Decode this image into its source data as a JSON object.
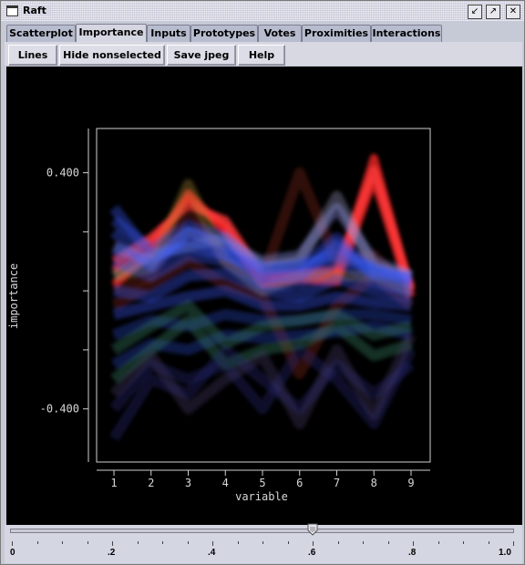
{
  "window": {
    "title": "Raft"
  },
  "tabs": [
    {
      "label": "Scatterplot",
      "active": false
    },
    {
      "label": "Importance",
      "active": true
    },
    {
      "label": "Inputs",
      "active": false
    },
    {
      "label": "Prototypes",
      "active": false
    },
    {
      "label": "Votes",
      "active": false
    },
    {
      "label": "Proximities",
      "active": false
    },
    {
      "label": "Interactions",
      "active": false
    }
  ],
  "toolbar": {
    "lines": "Lines",
    "hide_nonselected": "Hide nonselected",
    "save_jpeg": "Save jpeg",
    "help": "Help"
  },
  "colors": {
    "plot_bg": "#000000",
    "frame": "#d0d0d0",
    "highlight": "#ff2a2a",
    "bulk": "#3a5cff"
  },
  "chart_data": {
    "type": "line",
    "xlabel": "variable",
    "ylabel": "importance",
    "x": [
      1,
      2,
      3,
      4,
      5,
      6,
      7,
      8,
      9
    ],
    "y_ticks": [
      "0.400",
      "-0.400"
    ],
    "ylim": [
      -0.58,
      0.55
    ],
    "series": [
      {
        "color": "#ff2a2a",
        "values": [
          0.07,
          0.16,
          0.31,
          0.22,
          0.03,
          0.05,
          0.05,
          0.45,
          0.0
        ]
      },
      {
        "color": "#ff2a2a",
        "values": [
          0.02,
          0.13,
          0.33,
          0.2,
          0.02,
          0.04,
          0.03,
          0.38,
          -0.02
        ]
      },
      {
        "color": "#ff3a3a",
        "values": [
          0.1,
          0.18,
          0.29,
          0.24,
          0.05,
          0.06,
          0.07,
          0.41,
          0.01
        ]
      },
      {
        "color": "#8a2a1a",
        "values": [
          0.0,
          0.05,
          0.28,
          0.1,
          0.04,
          0.4,
          0.1,
          0.12,
          -0.02
        ]
      },
      {
        "color": "#8a2a1a",
        "values": [
          -0.05,
          0.02,
          0.1,
          0.02,
          -0.02,
          -0.28,
          -0.05,
          0.05,
          -0.05
        ]
      },
      {
        "color": "#a0a0c8",
        "values": [
          0.05,
          0.12,
          0.15,
          0.18,
          0.08,
          0.1,
          0.32,
          0.08,
          0.05
        ]
      },
      {
        "color": "#9aa0ff",
        "values": [
          0.15,
          0.1,
          0.2,
          0.16,
          0.1,
          0.12,
          0.28,
          0.1,
          0.05
        ]
      },
      {
        "color": "#b08a30",
        "values": [
          0.05,
          0.08,
          0.36,
          0.1,
          0.0,
          0.05,
          0.05,
          0.05,
          0.0
        ]
      },
      {
        "color": "#3a5cff",
        "values": [
          0.28,
          0.12,
          0.15,
          0.12,
          0.08,
          0.08,
          0.18,
          0.06,
          0.05
        ]
      },
      {
        "color": "#3a5cff",
        "values": [
          0.2,
          0.08,
          0.2,
          0.15,
          0.05,
          0.06,
          0.14,
          0.08,
          0.03
        ]
      },
      {
        "color": "#3a5cff",
        "values": [
          0.1,
          0.05,
          0.12,
          0.1,
          0.02,
          0.02,
          0.1,
          0.03,
          0.0
        ]
      },
      {
        "color": "#3a5cff",
        "values": [
          0.0,
          -0.02,
          0.05,
          0.06,
          0.0,
          -0.02,
          0.04,
          0.0,
          -0.02
        ]
      },
      {
        "color": "#3a5cff",
        "values": [
          -0.08,
          -0.05,
          -0.02,
          0.0,
          -0.05,
          -0.05,
          -0.02,
          -0.04,
          -0.05
        ]
      },
      {
        "color": "#2f48c8",
        "values": [
          -0.15,
          -0.1,
          -0.12,
          -0.08,
          -0.1,
          -0.1,
          -0.08,
          -0.08,
          -0.1
        ]
      },
      {
        "color": "#2f48c8",
        "values": [
          -0.25,
          -0.18,
          -0.2,
          -0.15,
          -0.16,
          -0.15,
          -0.14,
          -0.12,
          -0.15
        ]
      },
      {
        "color": "#3a8a6a",
        "values": [
          -0.2,
          -0.12,
          -0.05,
          -0.18,
          -0.12,
          -0.1,
          -0.08,
          -0.15,
          -0.12
        ]
      },
      {
        "color": "#3a8a6a",
        "values": [
          -0.3,
          -0.2,
          -0.1,
          -0.25,
          -0.2,
          -0.18,
          -0.12,
          -0.22,
          -0.18
        ]
      },
      {
        "color": "#262a7a",
        "values": [
          -0.4,
          -0.25,
          -0.3,
          -0.25,
          -0.4,
          -0.2,
          -0.3,
          -0.45,
          -0.2
        ]
      },
      {
        "color": "#262a7a",
        "values": [
          -0.5,
          -0.3,
          -0.35,
          -0.2,
          -0.3,
          -0.4,
          -0.25,
          -0.35,
          -0.25
        ]
      },
      {
        "color": "#4a3a6a",
        "values": [
          -0.35,
          -0.22,
          -0.4,
          -0.3,
          -0.22,
          -0.45,
          -0.2,
          -0.42,
          -0.15
        ]
      },
      {
        "color": "#3a5cff",
        "values": [
          0.24,
          0.14,
          0.22,
          0.18,
          0.07,
          0.09,
          0.12,
          0.07,
          0.04
        ]
      },
      {
        "color": "#3a5cff",
        "values": [
          0.14,
          0.09,
          0.17,
          0.13,
          0.04,
          0.05,
          0.16,
          0.05,
          0.02
        ]
      }
    ]
  },
  "slider": {
    "value": 0.6,
    "labels": [
      "0",
      ".2",
      ".4",
      ".6",
      ".8",
      "1.0"
    ]
  }
}
